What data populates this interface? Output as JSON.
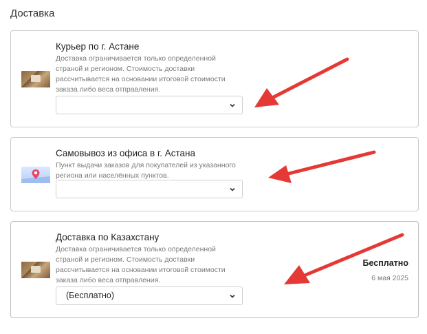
{
  "section_title": "Доставка",
  "options": [
    {
      "title": "Курьер по г. Астане",
      "description": "Доставка ограничивается только определенной страной и регионом. Стоимость доставки рассчитывается на основании итоговой стоимости заказа либо веса отправления.",
      "select_value": "",
      "icon": "parcel-icon"
    },
    {
      "title": "Самовывоз из офиса в г. Астана",
      "description": "Пункт выдачи заказов для покупателей из указанного региона или населённых пунктов.",
      "select_value": "",
      "icon": "map-pin-icon"
    },
    {
      "title": "Доставка по Казахстану",
      "description": "Доставка ограничивается только определенной страной и регионом. Стоимость доставки рассчитывается на основании итоговой стоимости заказа либо веса отправления.",
      "select_value": "(Бесплатно)",
      "price": "Бесплатно",
      "date": "6 мая 2025",
      "icon": "parcel-icon"
    }
  ],
  "colors": {
    "arrow": "#e53935",
    "border": "#c9c9c9",
    "muted_text": "#7a7a7a"
  }
}
